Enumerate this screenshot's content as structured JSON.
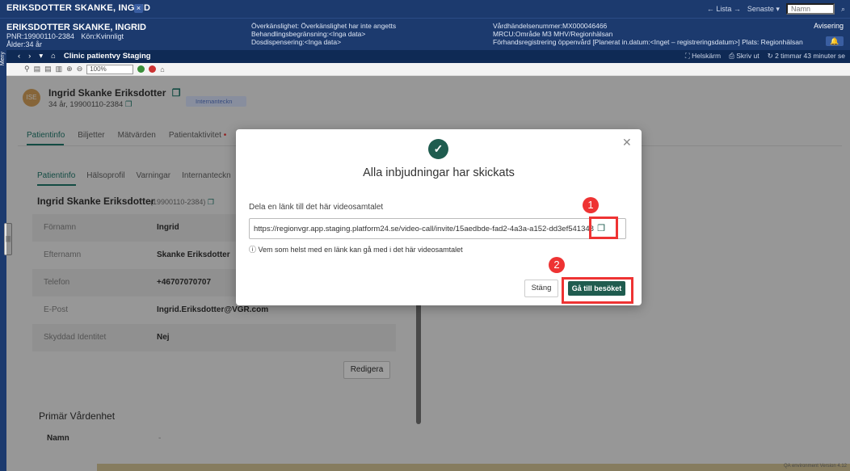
{
  "window": {
    "title": "ERIKSDOTTER SKANKE, INGRID",
    "close": "×",
    "lista": "← Lista →",
    "senaste": "Senaste ▾",
    "search_placeholder": "Namn",
    "avisering": "Avisering"
  },
  "patient_header": {
    "name": "ERIKSDOTTER SKANKE, INGRID",
    "pnr": "PNR:19900110-2384",
    "kon": "Kön:Kvinnligt",
    "alder": "Ålder:34 år",
    "overkanslighet": "Överkänslighet: Överkänslighet har inte angetts",
    "behandling": "Behandlingsbegränsning:<Inga data>",
    "dosdisp": "Dosdispensering:<Inga data>",
    "vardhandelse": "Vårdhändelsenummer:MX000046466",
    "mrcu": "MRCU:Område M3 MHV/Regionhälsan",
    "forhand": "Förhandsregistrering öppenvård [Planerat in.datum:<Inget – registreringsdatum>] Plats: Regionhälsan"
  },
  "navbar": {
    "unit": "Clinic patientvy Staging",
    "helskarm": "Helskärm",
    "skriv_ut": "Skriv ut",
    "timer": "2 timmar 43 minuter se"
  },
  "meny": "Meny",
  "toolbar": {
    "zoom": "100%"
  },
  "patient_card": {
    "initials": "ISE",
    "name": "Ingrid Skanke Eriksdotter",
    "sub": "34 år, 19900110-2384",
    "badge": "Internanteckn"
  },
  "tabs": [
    "Patientinfo",
    "Biljetter",
    "Mätvärden",
    "Patientaktivitet"
  ],
  "subtabs": [
    "Patientinfo",
    "Hälsoprofil",
    "Varningar",
    "Internanteckn"
  ],
  "section": {
    "title": "Ingrid Skanke Eriksdotter",
    "id": "(19900110-2384)"
  },
  "fields": [
    {
      "label": "Förnamn",
      "value": "Ingrid"
    },
    {
      "label": "Efternamn",
      "value": "Skanke Eriksdotter"
    },
    {
      "label": "Telefon",
      "value": "+46707070707"
    },
    {
      "label": "E-Post",
      "value": "Ingrid.Eriksdotter@VGR.com"
    },
    {
      "label": "Skyddad Identitet",
      "value": "Nej"
    }
  ],
  "redigera": "Redigera",
  "primar": {
    "title": "Primär Vårdenhet",
    "namn_label": "Namn",
    "namn_value": "-"
  },
  "footer_text": "QA environment Version 4.12",
  "modal": {
    "title": "Alla inbjudningar har skickats",
    "share_label": "Dela en länk till det här videosamtalet",
    "link": "https://regionvgr.app.staging.platform24.se/video-call/invite/15aedbde-fad2-4a3a-a152-dd3ef5413489",
    "note": "Vem som helst med en länk kan gå med i det här videosamtalet",
    "close_label": "Stäng",
    "go_label": "Gå till besöket"
  },
  "callouts": {
    "one": "1",
    "two": "2"
  },
  "colors": {
    "header": "#1c3a6e",
    "primary": "#1f5c4f",
    "highlight": "#e33333"
  }
}
